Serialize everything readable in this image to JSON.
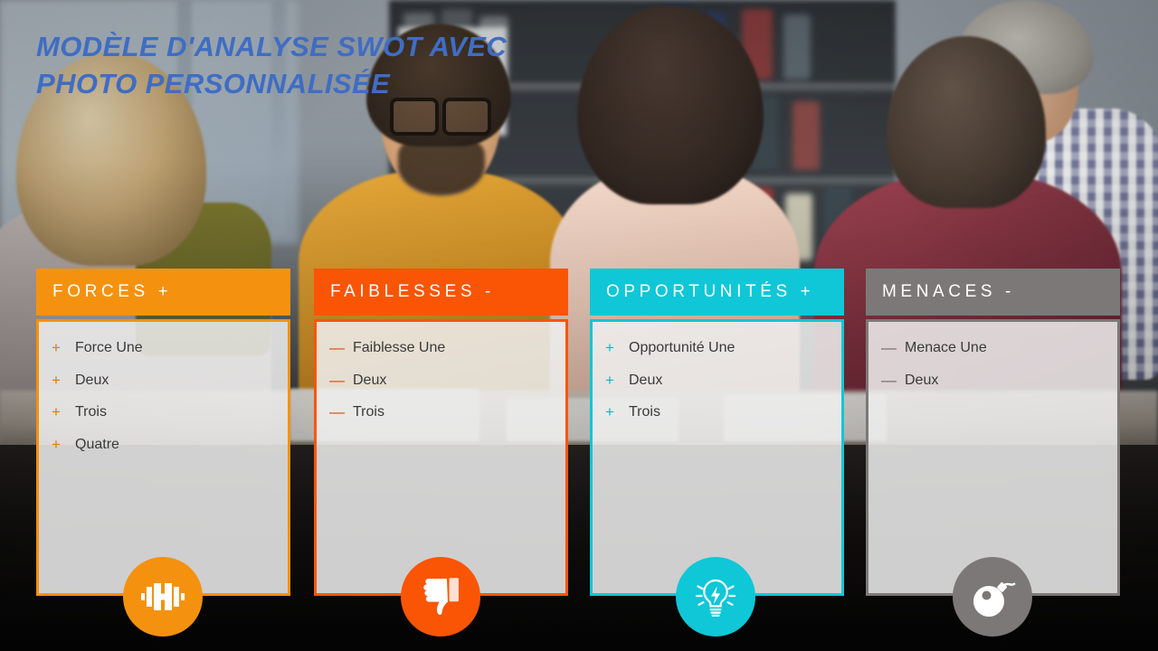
{
  "slide": {
    "title": "MODÈLE D'ANALYSE SWOT AVEC\nPHOTO PERSONNALISÉE",
    "title_color": "#3f6dc4"
  },
  "cards": [
    {
      "key": "strengths",
      "header": "FORCES  +",
      "accent": "#f4920f",
      "bullet": "+",
      "icon": "dumbbell-icon",
      "items": [
        {
          "bullet": "+",
          "label": "Force Une"
        },
        {
          "bullet": "+",
          "label": "Deux"
        },
        {
          "bullet": "+",
          "label": "Trois"
        },
        {
          "bullet": "+",
          "label": "Quatre"
        }
      ]
    },
    {
      "key": "weaknesses",
      "header": "FAIBLESSES  -",
      "accent": "#fa5505",
      "bullet": "—",
      "icon": "thumbs-down-icon",
      "items": [
        {
          "bullet": "—",
          "label": "Faiblesse Une"
        },
        {
          "bullet": "—",
          "label": "Deux"
        },
        {
          "bullet": "—",
          "label": "Trois"
        }
      ]
    },
    {
      "key": "opportunities",
      "header": "OPPORTUNITÉS  +",
      "accent": "#0fc7d6",
      "bullet": "+",
      "icon": "lightbulb-icon",
      "items": [
        {
          "bullet": "+",
          "label": "Opportunité Une"
        },
        {
          "bullet": "+",
          "label": "Deux"
        },
        {
          "bullet": "+",
          "label": "Trois"
        }
      ]
    },
    {
      "key": "threats",
      "header": "MENACES  -",
      "accent": "#7d7878",
      "bullet": "—",
      "icon": "bomb-icon",
      "items": [
        {
          "bullet": "—",
          "label": "Menace Une"
        },
        {
          "bullet": "—",
          "label": "Deux"
        }
      ]
    }
  ]
}
